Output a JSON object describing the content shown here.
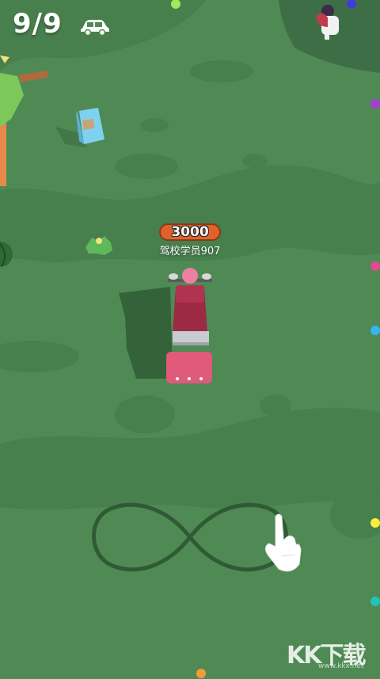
{
  "hud": {
    "counter": "9/9",
    "vehicle_icon": "car-icon"
  },
  "player": {
    "score": "3000",
    "name": "驾校学员907",
    "badge_color": "#e0622a",
    "vehicle_color": "#d8506e"
  },
  "tutorial": {
    "gesture_icon": "pointing-hand-icon",
    "path_shape": "infinity"
  },
  "watermark": {
    "text": "KK下载",
    "sub": "www.kkx.net"
  },
  "colors": {
    "grass": "#4f8a55",
    "grass_dark": "#447a4b",
    "path": "#2f5a35"
  }
}
